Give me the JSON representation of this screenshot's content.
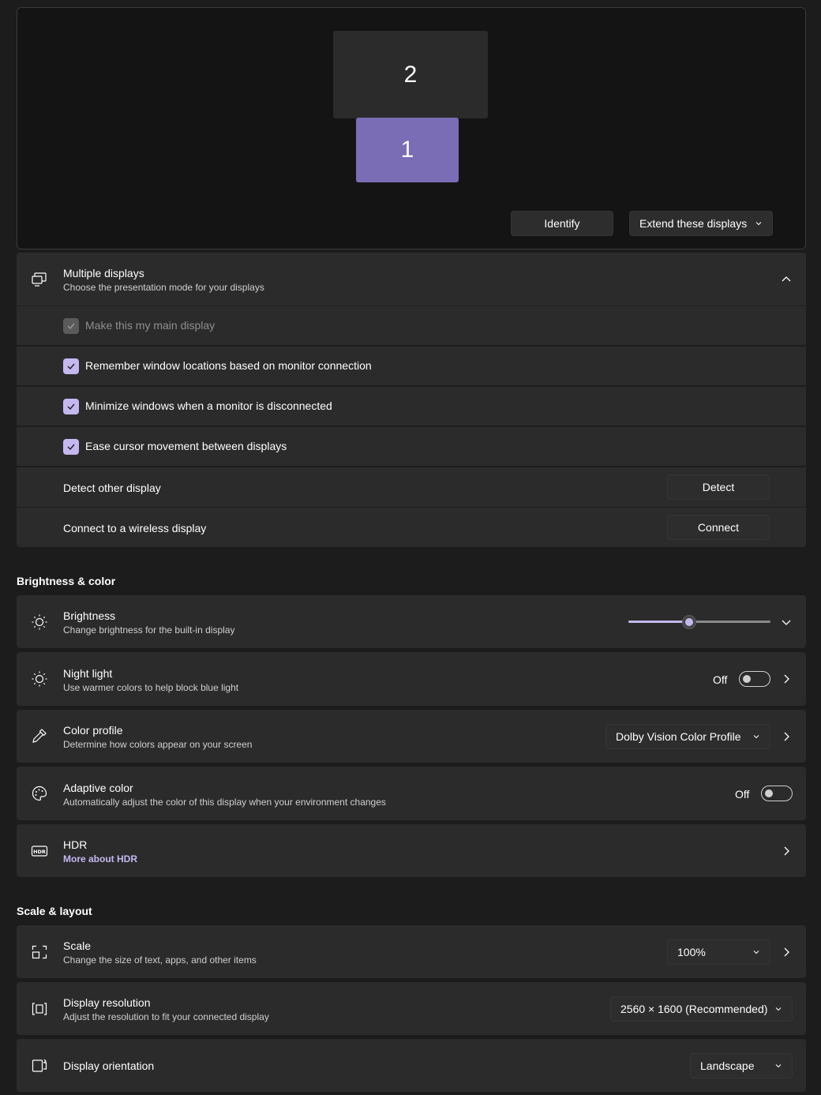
{
  "arrangement": {
    "monitor_2_label": "2",
    "monitor_1_label": "1",
    "identify_label": "Identify",
    "mode_selected": "Extend these displays",
    "accent_color": "#7b6cb6"
  },
  "multiple_displays": {
    "title": "Multiple displays",
    "subtitle": "Choose the presentation mode for your displays",
    "options": [
      {
        "label": "Make this my main display",
        "checked": true,
        "disabled": true
      },
      {
        "label": "Remember window locations based on monitor connection",
        "checked": true,
        "disabled": false
      },
      {
        "label": "Minimize windows when a monitor is disconnected",
        "checked": true,
        "disabled": false
      },
      {
        "label": "Ease cursor movement between displays",
        "checked": true,
        "disabled": false
      }
    ],
    "detect_label": "Detect other display",
    "detect_button": "Detect",
    "connect_label": "Connect to a wireless display",
    "connect_button": "Connect"
  },
  "brightness_color": {
    "section_title": "Brightness & color",
    "brightness": {
      "title": "Brightness",
      "subtitle": "Change brightness for the built-in display",
      "level_percent": 42
    },
    "night_light": {
      "title": "Night light",
      "subtitle": "Use warmer colors to help block blue light",
      "state": "Off"
    },
    "color_profile": {
      "title": "Color profile",
      "subtitle": "Determine how colors appear on your screen",
      "selected": "Dolby Vision Color Profile"
    },
    "adaptive_color": {
      "title": "Adaptive color",
      "subtitle": "Automatically adjust the color of this display when your environment changes",
      "state": "Off"
    },
    "hdr": {
      "title": "HDR",
      "link": "More about HDR"
    }
  },
  "scale_layout": {
    "section_title": "Scale & layout",
    "scale": {
      "title": "Scale",
      "subtitle": "Change the size of text, apps, and other items",
      "selected": "100%"
    },
    "resolution": {
      "title": "Display resolution",
      "subtitle": "Adjust the resolution to fit your connected display",
      "selected": "2560 × 1600 (Recommended)"
    },
    "orientation": {
      "title": "Display orientation",
      "selected": "Landscape"
    }
  }
}
